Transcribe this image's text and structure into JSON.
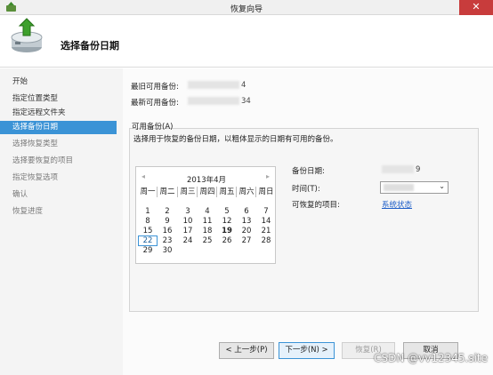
{
  "window": {
    "title": "恢复向导",
    "close_glyph": "✕"
  },
  "header": {
    "title": "选择备份日期",
    "icon": "restore-wizard-icon"
  },
  "sidebar": {
    "items": [
      {
        "label": "开始",
        "state": "normal"
      },
      {
        "label": "指定位置类型",
        "state": "normal"
      },
      {
        "label": "指定远程文件夹",
        "state": "normal"
      },
      {
        "label": "选择备份日期",
        "state": "active"
      },
      {
        "label": "选择恢复类型",
        "state": "disabled"
      },
      {
        "label": "选择要恢复的项目",
        "state": "disabled"
      },
      {
        "label": "指定恢复选项",
        "state": "disabled"
      },
      {
        "label": "确认",
        "state": "disabled"
      },
      {
        "label": "恢复进度",
        "state": "disabled"
      }
    ]
  },
  "info": {
    "oldest_label": "最旧可用备份:",
    "oldest_value_suffix": "4",
    "newest_label": "最新可用备份:",
    "newest_value_suffix": "34"
  },
  "available": {
    "group_title": "可用备份(A)",
    "description": "选择用于恢复的备份日期，以粗体显示的日期有可用的备份。"
  },
  "calendar": {
    "prev": "◂",
    "next": "▸",
    "month_title": "2013年4月",
    "weekdays": [
      "周一",
      "周二",
      "周三",
      "周四",
      "周五",
      "周六",
      "周日"
    ],
    "weeks": [
      [
        "1",
        "2",
        "3",
        "4",
        "5",
        "6",
        "7"
      ],
      [
        "8",
        "9",
        "10",
        "11",
        "12",
        "13",
        "14"
      ],
      [
        "15",
        "16",
        "17",
        "18",
        "19",
        "20",
        "21"
      ],
      [
        "22",
        "23",
        "24",
        "25",
        "26",
        "27",
        "28"
      ],
      [
        "29",
        "30",
        "",
        "",
        "",
        "",
        ""
      ]
    ],
    "bold_day": "19",
    "today": "22"
  },
  "details": {
    "backup_date_label": "备份日期:",
    "backup_date_suffix": "9",
    "time_label": "时间(T):",
    "time_arrow": "⌄",
    "recoverable_label": "可恢复的项目:",
    "recoverable_link": "系统状态"
  },
  "buttons": {
    "back": "< 上一步(P)",
    "next": "下一步(N) >",
    "recover": "恢复(R)",
    "cancel": "取消"
  },
  "watermark": "CSDN @vv12345.site"
}
